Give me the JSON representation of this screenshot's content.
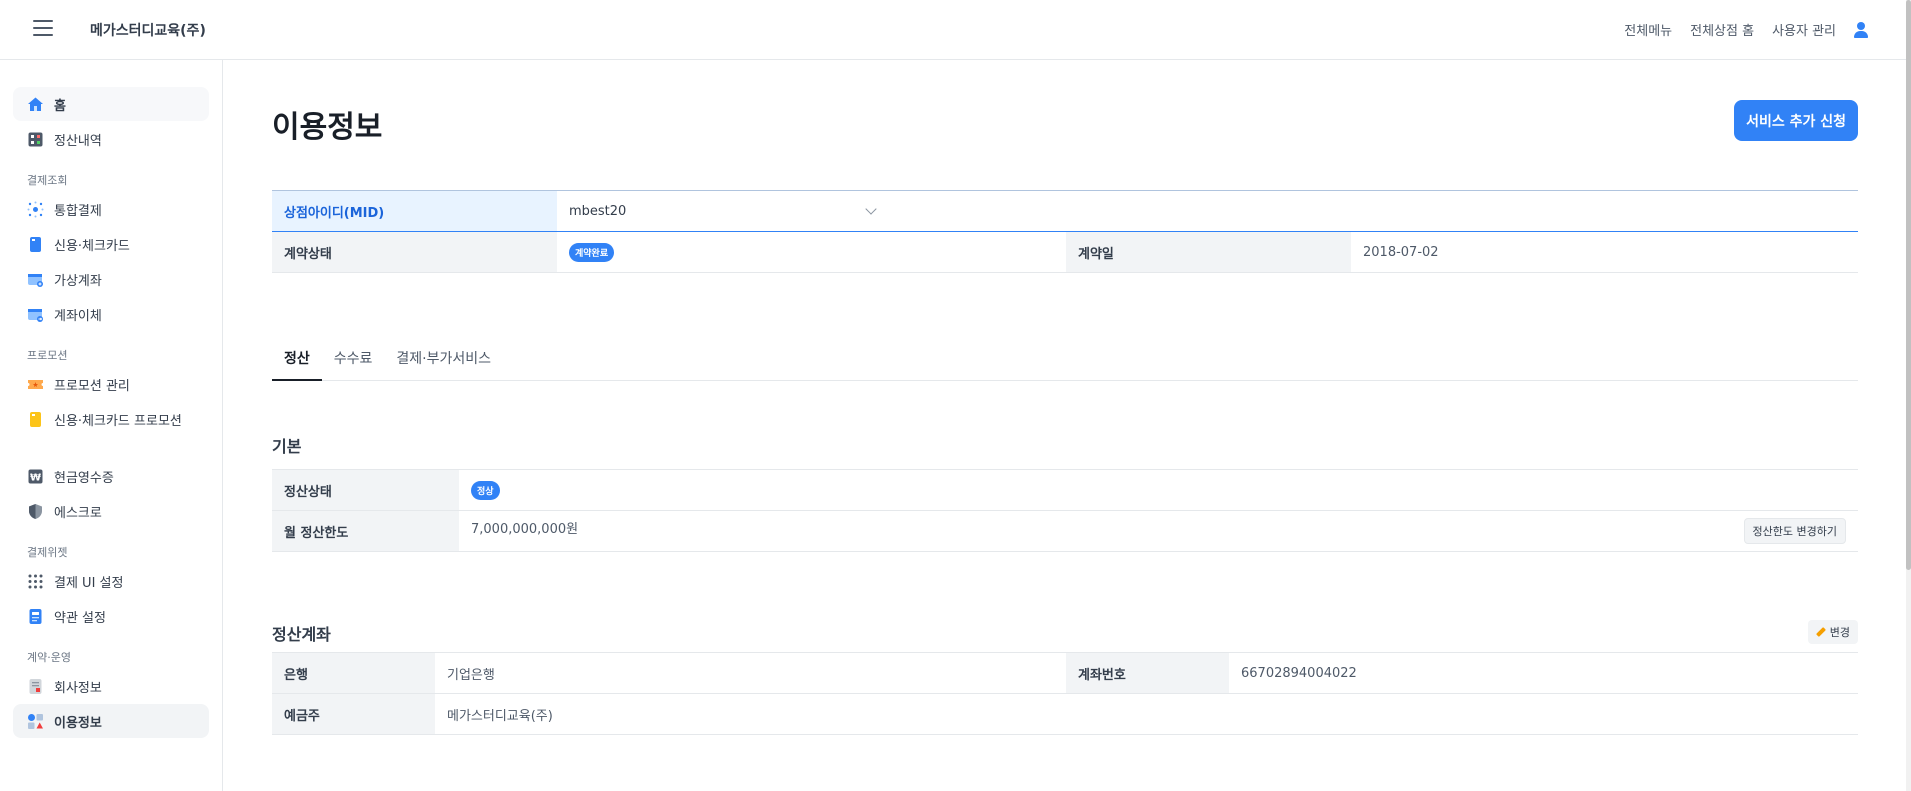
{
  "header": {
    "brand": "메가스터디교육(주)",
    "links": [
      "전체메뉴",
      "전체상점 홈",
      "사용자 관리"
    ]
  },
  "sidebar": {
    "home": "홈",
    "settlement_history": "정산내역",
    "groups": [
      {
        "label": "결제조회",
        "items": [
          "통합결제",
          "신용·체크카드",
          "가상계좌",
          "계좌이체"
        ]
      },
      {
        "label": "프로모션",
        "items": [
          "프로모션 관리",
          "신용·체크카드 프로모션"
        ]
      },
      {
        "label": "",
        "items": [
          "현금영수증",
          "에스크로"
        ]
      },
      {
        "label": "결제위젯",
        "items": [
          "결제 UI 설정",
          "약관 설정"
        ]
      },
      {
        "label": "계약·운영",
        "items": [
          "회사정보",
          "이용정보"
        ]
      }
    ]
  },
  "main": {
    "title": "이용정보",
    "add_service_button": "서비스 추가 신청",
    "mid": {
      "label": "상점아이디(MID)",
      "value": "mbest20"
    },
    "contract": {
      "status_label": "계약상태",
      "status_badge": "계약완료",
      "date_label": "계약일",
      "date_value": "2018-07-02"
    },
    "tabs": [
      "정산",
      "수수료",
      "결제·부가서비스"
    ],
    "basic": {
      "title": "기본",
      "status_label": "정산상태",
      "status_badge": "정상",
      "limit_label": "월 정산한도",
      "limit_value": "7,000,000,000원",
      "limit_change_button": "정산한도 변경하기"
    },
    "account": {
      "title": "정산계좌",
      "edit_button": "변경",
      "bank_label": "은행",
      "bank_value": "기업은행",
      "number_label": "계좌번호",
      "number_value": "66702894004022",
      "holder_label": "예금주",
      "holder_value": "메가스터디교육(주)"
    }
  },
  "colors": {
    "accent": "#3182f6",
    "active_bg": "#f2f4f6"
  }
}
